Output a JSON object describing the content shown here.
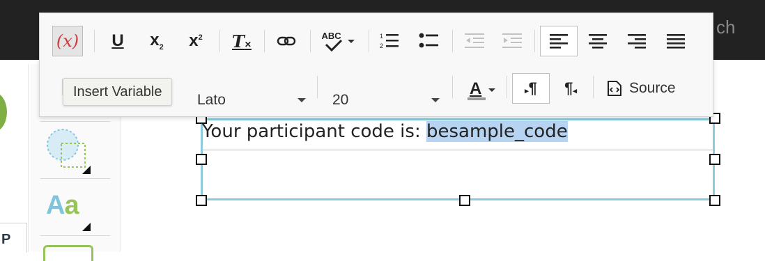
{
  "header": {
    "partial_text": "ch"
  },
  "left_tab": {
    "label": "P"
  },
  "tools": {
    "text_tool_label": "Aa"
  },
  "toolbar": {
    "insert_variable_glyph": "(x)",
    "underline_glyph": "U",
    "subscript_glyph": "x",
    "superscript_glyph": "x",
    "subscript_mark": "2",
    "superscript_mark": "2",
    "remove_format_glyph": "T",
    "spellcheck_glyph": "ABC",
    "font_family": "Lato",
    "font_size": "20",
    "text_color_glyph": "A",
    "ltr_glyph": "¶",
    "rtl_glyph": "¶",
    "source_label": "Source"
  },
  "tooltip": {
    "text": "Insert Variable"
  },
  "editor": {
    "prefix": "Your participant code is: ",
    "variable": "besample_code"
  },
  "colors": {
    "accent_red": "#d13b3b",
    "textbox_border": "#8ccbdc",
    "selection": "#b7d3f2"
  }
}
